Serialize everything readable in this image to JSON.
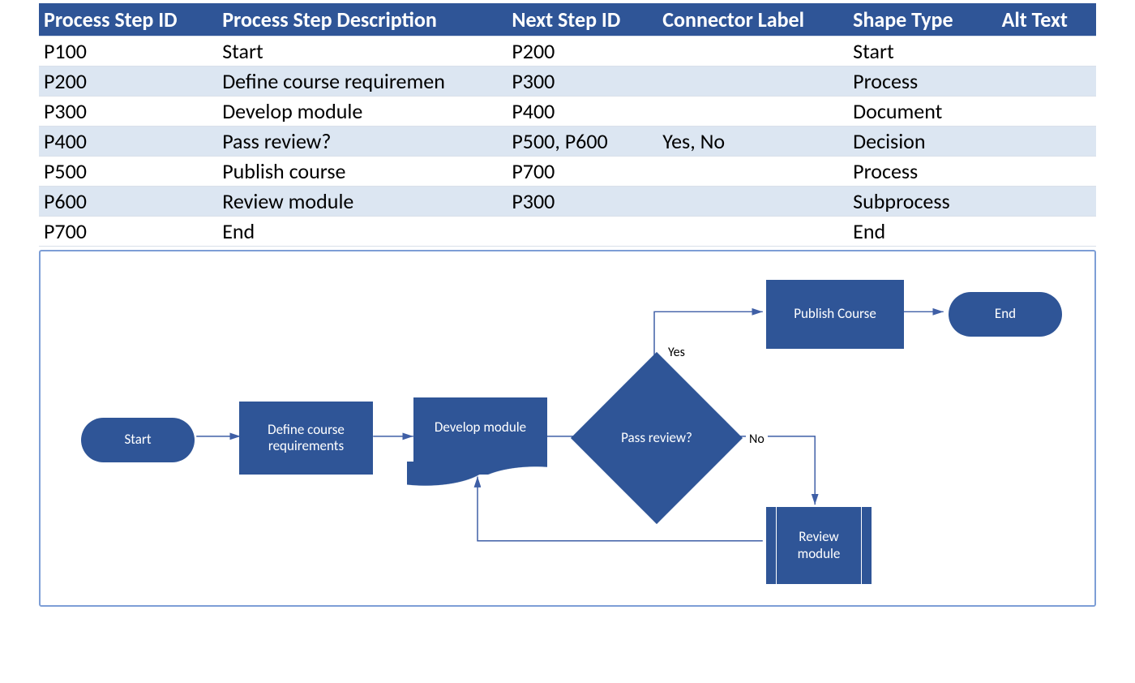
{
  "table": {
    "headers": {
      "step_id": "Process Step ID",
      "description": "Process Step Description",
      "next_id": "Next Step ID",
      "connector_label": "Connector Label",
      "shape_type": "Shape Type",
      "alt_text": "Alt Text"
    },
    "rows": [
      {
        "step_id": "P100",
        "description": "Start",
        "next_id": "P200",
        "connector_label": "",
        "shape_type": "Start",
        "alt_text": ""
      },
      {
        "step_id": "P200",
        "description": "Define course requiremen",
        "next_id": "P300",
        "connector_label": "",
        "shape_type": "Process",
        "alt_text": ""
      },
      {
        "step_id": "P300",
        "description": "Develop module",
        "next_id": "P400",
        "connector_label": "",
        "shape_type": "Document",
        "alt_text": ""
      },
      {
        "step_id": "P400",
        "description": "Pass review?",
        "next_id": "P500, P600",
        "connector_label": "Yes, No",
        "shape_type": "Decision",
        "alt_text": ""
      },
      {
        "step_id": "P500",
        "description": "Publish course",
        "next_id": "P700",
        "connector_label": "",
        "shape_type": "Process",
        "alt_text": ""
      },
      {
        "step_id": "P600",
        "description": "Review module",
        "next_id": "P300",
        "connector_label": "",
        "shape_type": "Subprocess",
        "alt_text": ""
      },
      {
        "step_id": "P700",
        "description": "End",
        "next_id": "",
        "connector_label": "",
        "shape_type": "End",
        "alt_text": ""
      }
    ]
  },
  "diagram": {
    "shapes": {
      "start": {
        "label": "Start"
      },
      "define": {
        "label": "Define course requirements"
      },
      "develop": {
        "label": "Develop module"
      },
      "decide": {
        "label": "Pass review?"
      },
      "publish": {
        "label": "Publish Course"
      },
      "end": {
        "label": "End"
      },
      "review": {
        "label": "Review module"
      }
    },
    "edges": {
      "yes": "Yes",
      "no": "No"
    }
  },
  "colors": {
    "header": "#2f5597",
    "band": "#dce6f2",
    "shape": "#2f5597",
    "line": "#3f5fa6"
  }
}
